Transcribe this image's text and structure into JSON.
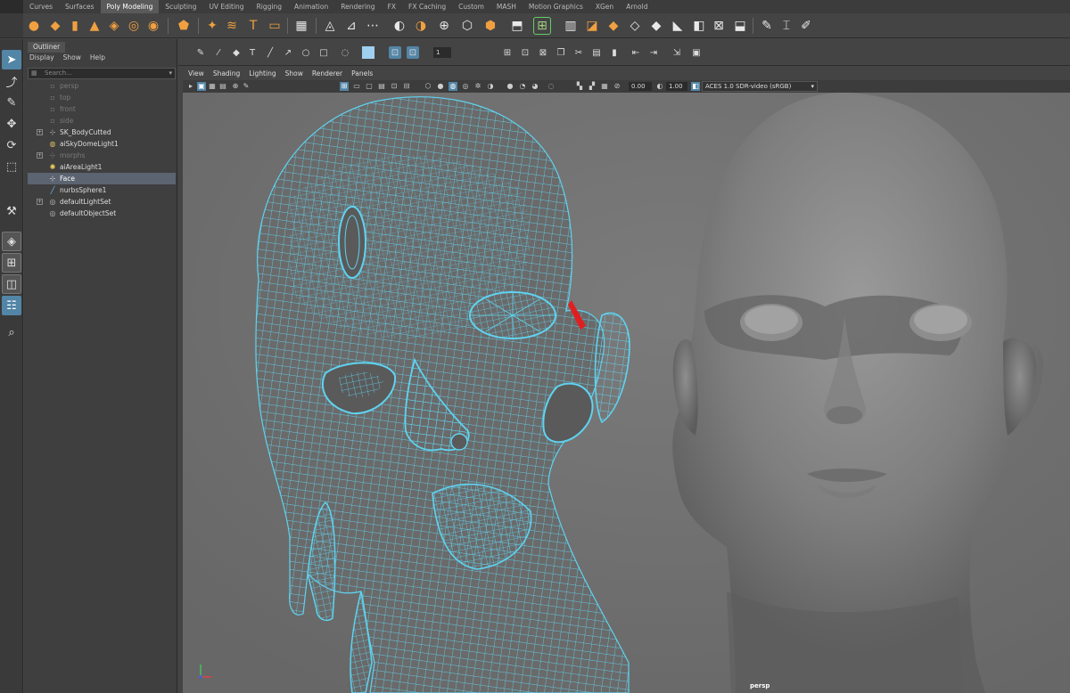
{
  "shelf_tabs": [
    "Curves",
    "Surfaces",
    "Poly Modeling",
    "Sculpting",
    "UV Editing",
    "Rigging",
    "Animation",
    "Rendering",
    "FX",
    "FX Caching",
    "Custom",
    "MASH",
    "Motion Graphics",
    "XGen",
    "Arnold"
  ],
  "active_shelf_tab": "Poly Modeling",
  "outliner": {
    "title": "Outliner",
    "menu": [
      "Display",
      "Show",
      "Help"
    ],
    "search_placeholder": "Search...",
    "items": [
      {
        "label": "persp",
        "dim": true,
        "icon": "camera-icon"
      },
      {
        "label": "top",
        "dim": true,
        "icon": "camera-icon"
      },
      {
        "label": "front",
        "dim": true,
        "icon": "camera-icon"
      },
      {
        "label": "side",
        "dim": true,
        "icon": "camera-icon"
      },
      {
        "label": "SK_BodyCutted",
        "dim": false,
        "icon": "transform-icon",
        "expandable": true
      },
      {
        "label": "aiSkyDomeLight1",
        "dim": false,
        "icon": "skydome-icon"
      },
      {
        "label": "morphs",
        "dim": true,
        "icon": "transform-icon",
        "expandable": true
      },
      {
        "label": "aiAreaLight1",
        "dim": false,
        "icon": "light-icon"
      },
      {
        "label": "Face",
        "dim": false,
        "icon": "transform-icon",
        "selected": true
      },
      {
        "label": "nurbsSphere1",
        "dim": false,
        "icon": "nurbs-icon"
      },
      {
        "label": "defaultLightSet",
        "dim": false,
        "icon": "set-icon",
        "expandable": true
      },
      {
        "label": "defaultObjectSet",
        "dim": false,
        "icon": "set-icon"
      }
    ]
  },
  "viewport": {
    "menu": [
      "View",
      "Shading",
      "Lighting",
      "Show",
      "Renderer",
      "Panels"
    ],
    "field_a": "0.00",
    "field_b": "1.00",
    "color_space": "ACES 1.0 SDR-video (sRGB)",
    "camera": "persp"
  },
  "statusline": {
    "number_field": "1"
  },
  "logo": "M",
  "colors": {
    "wire": "#5fd3f0",
    "accent": "#5285a6",
    "selection": "#5b6470"
  }
}
